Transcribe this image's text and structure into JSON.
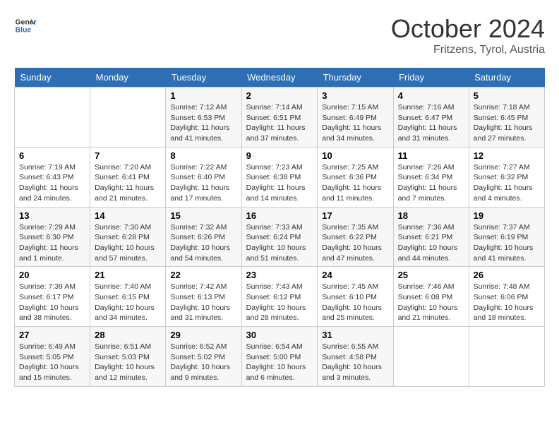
{
  "header": {
    "logo_line1": "General",
    "logo_line2": "Blue",
    "month": "October 2024",
    "location": "Fritzens, Tyrol, Austria"
  },
  "days_of_week": [
    "Sunday",
    "Monday",
    "Tuesday",
    "Wednesday",
    "Thursday",
    "Friday",
    "Saturday"
  ],
  "weeks": [
    [
      {
        "day": "",
        "info": ""
      },
      {
        "day": "",
        "info": ""
      },
      {
        "day": "1",
        "info": "Sunrise: 7:12 AM\nSunset: 6:53 PM\nDaylight: 11 hours and 41 minutes."
      },
      {
        "day": "2",
        "info": "Sunrise: 7:14 AM\nSunset: 6:51 PM\nDaylight: 11 hours and 37 minutes."
      },
      {
        "day": "3",
        "info": "Sunrise: 7:15 AM\nSunset: 6:49 PM\nDaylight: 11 hours and 34 minutes."
      },
      {
        "day": "4",
        "info": "Sunrise: 7:16 AM\nSunset: 6:47 PM\nDaylight: 11 hours and 31 minutes."
      },
      {
        "day": "5",
        "info": "Sunrise: 7:18 AM\nSunset: 6:45 PM\nDaylight: 11 hours and 27 minutes."
      }
    ],
    [
      {
        "day": "6",
        "info": "Sunrise: 7:19 AM\nSunset: 6:43 PM\nDaylight: 11 hours and 24 minutes."
      },
      {
        "day": "7",
        "info": "Sunrise: 7:20 AM\nSunset: 6:41 PM\nDaylight: 11 hours and 21 minutes."
      },
      {
        "day": "8",
        "info": "Sunrise: 7:22 AM\nSunset: 6:40 PM\nDaylight: 11 hours and 17 minutes."
      },
      {
        "day": "9",
        "info": "Sunrise: 7:23 AM\nSunset: 6:38 PM\nDaylight: 11 hours and 14 minutes."
      },
      {
        "day": "10",
        "info": "Sunrise: 7:25 AM\nSunset: 6:36 PM\nDaylight: 11 hours and 11 minutes."
      },
      {
        "day": "11",
        "info": "Sunrise: 7:26 AM\nSunset: 6:34 PM\nDaylight: 11 hours and 7 minutes."
      },
      {
        "day": "12",
        "info": "Sunrise: 7:27 AM\nSunset: 6:32 PM\nDaylight: 11 hours and 4 minutes."
      }
    ],
    [
      {
        "day": "13",
        "info": "Sunrise: 7:29 AM\nSunset: 6:30 PM\nDaylight: 11 hours and 1 minute."
      },
      {
        "day": "14",
        "info": "Sunrise: 7:30 AM\nSunset: 6:28 PM\nDaylight: 10 hours and 57 minutes."
      },
      {
        "day": "15",
        "info": "Sunrise: 7:32 AM\nSunset: 6:26 PM\nDaylight: 10 hours and 54 minutes."
      },
      {
        "day": "16",
        "info": "Sunrise: 7:33 AM\nSunset: 6:24 PM\nDaylight: 10 hours and 51 minutes."
      },
      {
        "day": "17",
        "info": "Sunrise: 7:35 AM\nSunset: 6:22 PM\nDaylight: 10 hours and 47 minutes."
      },
      {
        "day": "18",
        "info": "Sunrise: 7:36 AM\nSunset: 6:21 PM\nDaylight: 10 hours and 44 minutes."
      },
      {
        "day": "19",
        "info": "Sunrise: 7:37 AM\nSunset: 6:19 PM\nDaylight: 10 hours and 41 minutes."
      }
    ],
    [
      {
        "day": "20",
        "info": "Sunrise: 7:39 AM\nSunset: 6:17 PM\nDaylight: 10 hours and 38 minutes."
      },
      {
        "day": "21",
        "info": "Sunrise: 7:40 AM\nSunset: 6:15 PM\nDaylight: 10 hours and 34 minutes."
      },
      {
        "day": "22",
        "info": "Sunrise: 7:42 AM\nSunset: 6:13 PM\nDaylight: 10 hours and 31 minutes."
      },
      {
        "day": "23",
        "info": "Sunrise: 7:43 AM\nSunset: 6:12 PM\nDaylight: 10 hours and 28 minutes."
      },
      {
        "day": "24",
        "info": "Sunrise: 7:45 AM\nSunset: 6:10 PM\nDaylight: 10 hours and 25 minutes."
      },
      {
        "day": "25",
        "info": "Sunrise: 7:46 AM\nSunset: 6:08 PM\nDaylight: 10 hours and 21 minutes."
      },
      {
        "day": "26",
        "info": "Sunrise: 7:48 AM\nSunset: 6:06 PM\nDaylight: 10 hours and 18 minutes."
      }
    ],
    [
      {
        "day": "27",
        "info": "Sunrise: 6:49 AM\nSunset: 5:05 PM\nDaylight: 10 hours and 15 minutes."
      },
      {
        "day": "28",
        "info": "Sunrise: 6:51 AM\nSunset: 5:03 PM\nDaylight: 10 hours and 12 minutes."
      },
      {
        "day": "29",
        "info": "Sunrise: 6:52 AM\nSunset: 5:02 PM\nDaylight: 10 hours and 9 minutes."
      },
      {
        "day": "30",
        "info": "Sunrise: 6:54 AM\nSunset: 5:00 PM\nDaylight: 10 hours and 6 minutes."
      },
      {
        "day": "31",
        "info": "Sunrise: 6:55 AM\nSunset: 4:58 PM\nDaylight: 10 hours and 3 minutes."
      },
      {
        "day": "",
        "info": ""
      },
      {
        "day": "",
        "info": ""
      }
    ]
  ]
}
